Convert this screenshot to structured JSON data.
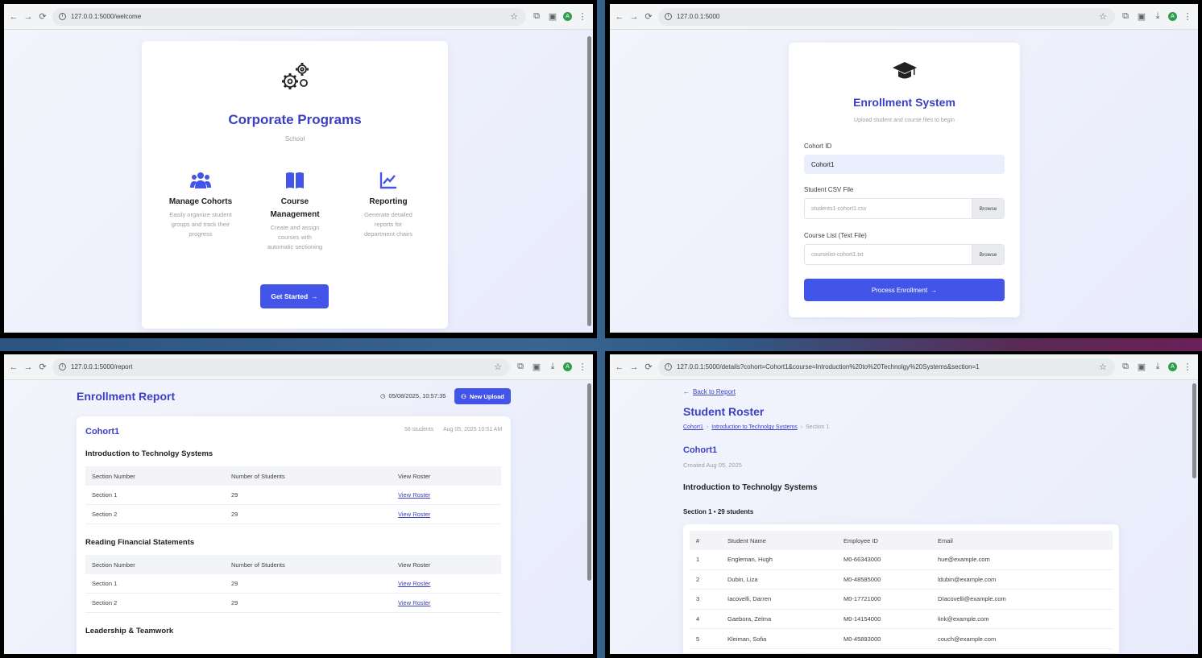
{
  "browser": {
    "back": "←",
    "forward": "→",
    "reload": "⟳",
    "star": "☆",
    "extensions": "⧉",
    "sidepanel": "▣",
    "download": "⤓",
    "avatar": "A",
    "menu": "⋮"
  },
  "welcome": {
    "url": "127.0.0.1:5000/welcome",
    "title": "Corporate Programs",
    "subtitle": "School",
    "features": [
      {
        "title": "Manage Cohorts",
        "desc": [
          "Easily organize student",
          "groups and track their",
          "progress"
        ]
      },
      {
        "title_lines": [
          "Course",
          "Management"
        ],
        "desc": [
          "Create and assign",
          "courses with",
          "automatic sectioning"
        ]
      },
      {
        "title": "Reporting",
        "desc": [
          "Generate detailed",
          "reports for",
          "department chairs"
        ]
      }
    ],
    "button": "Get Started",
    "colors": {
      "accent": "#3b3fc4",
      "button": "#4355e8"
    }
  },
  "enroll": {
    "url": "127.0.0.1:5000",
    "title": "Enrollment System",
    "subtitle": "Upload student and course files to begin",
    "cohort_label": "Cohort ID",
    "cohort_value": "Cohort1",
    "student_label": "Student CSV File",
    "student_file": "students1-cohort1.csv",
    "course_label": "Course List (Text File)",
    "course_file": "courselist-cohort1.txt",
    "browse": "Browse",
    "button": "Process Enrollment"
  },
  "report": {
    "url": "127.0.0.1:5000/report",
    "title": "Enrollment Report",
    "timestamp": "05/08/2025, 10:57:35",
    "new_upload": "New Upload",
    "cohort": "Cohort1",
    "students": "58 students",
    "date": "Aug 05, 2025 10:51 AM",
    "headers": [
      "Section Number",
      "Number of Students",
      "View Roster"
    ],
    "courses": [
      {
        "name": "Introduction to Technolgy Systems",
        "rows": [
          [
            "Section 1",
            "29",
            "View Roster"
          ],
          [
            "Section 2",
            "29",
            "View Roster"
          ]
        ]
      },
      {
        "name": "Reading Financial Statements",
        "rows": [
          [
            "Section 1",
            "29",
            "View Roster"
          ],
          [
            "Section 2",
            "29",
            "View Roster"
          ]
        ]
      },
      {
        "name": "Leadership & Teamwork",
        "rows": []
      }
    ]
  },
  "roster": {
    "url": "127.0.0.1:5000/details?cohort=Cohort1&course=Introduction%20to%20Technolgy%20Systems&section=1",
    "back": "Back to Report",
    "title": "Student Roster",
    "crumbs": [
      "Cohort1",
      "Introduction to Technolgy Systems",
      "Section 1"
    ],
    "cohort": "Cohort1",
    "created": "Created Aug 05, 2025",
    "course": "Introduction to Technolgy Systems",
    "section_info": "Section 1 • 29 students",
    "headers": [
      "#",
      "Student Name",
      "Employee ID",
      "Email"
    ],
    "rows": [
      [
        "1",
        "Engleman, Hugh",
        "M0-66343000",
        "hue@example.com"
      ],
      [
        "2",
        "Dubin, Liza",
        "M0-48585000",
        "ldubin@example.com"
      ],
      [
        "3",
        "Iacovelli, Darren",
        "M0-17721000",
        "DIacovelli@example.com"
      ],
      [
        "4",
        "Gaebora, Zelma",
        "M0-14154000",
        "link@example.com"
      ],
      [
        "5",
        "Kleiman, Sofia",
        "M0-45893000",
        "couch@example.com"
      ]
    ]
  }
}
